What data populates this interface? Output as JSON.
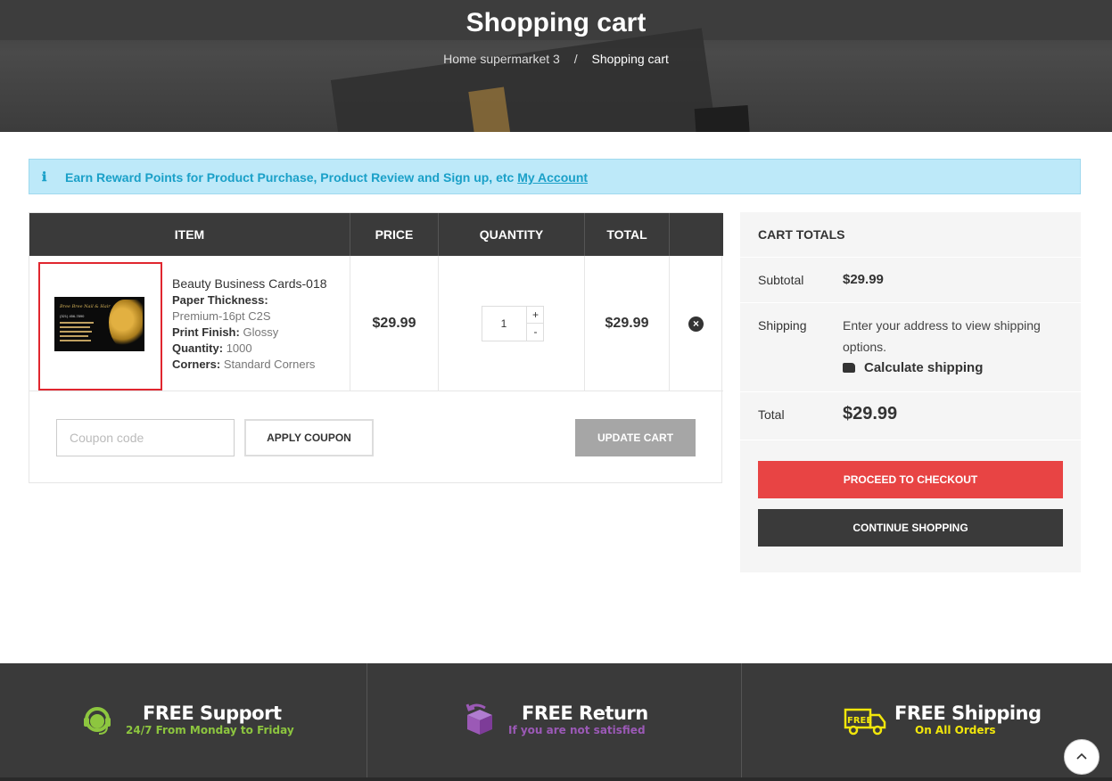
{
  "header": {
    "title": "Shopping cart",
    "breadcrumb": {
      "home": "Home supermarket 3",
      "separator": "/",
      "current": "Shopping cart"
    }
  },
  "notice": {
    "icon": "info-icon",
    "text": "Earn Reward Points for Product Purchase, Product Review and Sign up, etc ",
    "link": "My Account"
  },
  "cart": {
    "columns": {
      "item": "ITEM",
      "price": "PRICE",
      "quantity": "QUANTITY",
      "total": "TOTAL"
    },
    "items": [
      {
        "name": "Beauty Business Cards-018",
        "attrs": [
          {
            "label": "Paper Thickness:",
            "value": "Premium-16pt C2S"
          },
          {
            "label": "Print Finish:",
            "value": "Glossy"
          },
          {
            "label": "Quantity:",
            "value": "1000"
          },
          {
            "label": "Corners:",
            "value": "Standard Corners"
          }
        ],
        "image_text": {
          "title": "Bree Bree Nail & Hair",
          "phone": "(321) 456-7890"
        },
        "price": "$29.99",
        "quantity": "1",
        "qty_plus": "+",
        "qty_minus": "-",
        "total": "$29.99",
        "remove": "×"
      }
    ],
    "coupon_placeholder": "Coupon code",
    "apply_coupon": "APPLY COUPON",
    "update_cart": "UPDATE CART"
  },
  "totals": {
    "heading": "CART TOTALS",
    "subtotal_label": "Subtotal",
    "subtotal": "$29.99",
    "shipping_label": "Shipping",
    "shipping_text": "Enter your address to view shipping options.",
    "calculate_shipping": "Calculate shipping",
    "total_label": "Total",
    "total": "$29.99",
    "checkout": "PROCEED TO CHECKOUT",
    "continue": "CONTINUE SHOPPING"
  },
  "features": [
    {
      "icon": "headset-icon",
      "title": "FREE Support",
      "subtitle": "24/7 From Monday to Friday",
      "color": "#8dc63f"
    },
    {
      "icon": "return-box-icon",
      "title": "FREE Return",
      "subtitle": "If you are not satisfied",
      "color": "#9b59b6"
    },
    {
      "icon": "free-truck-icon",
      "title": "FREE Shipping",
      "subtitle": "On All Orders",
      "color": "#f1e60b"
    }
  ],
  "scroll_top_icon": "chevron-up-icon",
  "colors": {
    "accent_red": "#e84444",
    "dark": "#3a3a3a",
    "notice_bg": "#bde9f9",
    "notice_text": "#1aa0c8"
  }
}
